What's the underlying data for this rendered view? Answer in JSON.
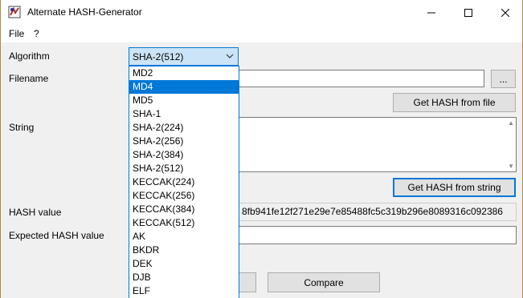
{
  "window": {
    "title": "Alternate HASH-Generator"
  },
  "menu": {
    "file": "File",
    "help": "?"
  },
  "labels": {
    "algorithm": "Algorithm",
    "filename": "Filename",
    "string": "String",
    "hash_value": "HASH value",
    "expected_hash": "Expected HASH value"
  },
  "algorithm": {
    "selected": "SHA-2(512)"
  },
  "dropdown": {
    "items": [
      "MD2",
      "MD4",
      "MD5",
      "SHA-1",
      "SHA-2(224)",
      "SHA-2(256)",
      "SHA-2(384)",
      "SHA-2(512)",
      "KECCAK(224)",
      "KECCAK(256)",
      "KECCAK(384)",
      "KECCAK(512)",
      "AK",
      "BKDR",
      "DEK",
      "DJB",
      "ELF"
    ],
    "highlighted_index": 1
  },
  "filename": {
    "value": "",
    "browse_label": "..."
  },
  "buttons": {
    "get_hash_file": "Get HASH from file",
    "get_hash_string": "Get HASH from string",
    "compare": "Compare"
  },
  "hash": {
    "value": "8fb941fe12f271e29e7e85488fc5c319b296e8089316c092386"
  },
  "expected": {
    "value": ""
  },
  "colors": {
    "accent": "#0078d7",
    "selection": "#cce4f7"
  }
}
